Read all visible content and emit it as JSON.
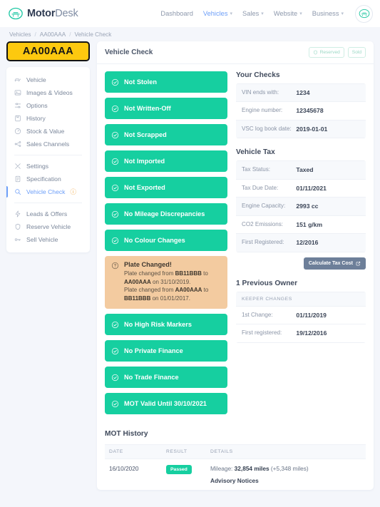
{
  "brand": {
    "name_bold": "Motor",
    "name_light": "Desk",
    "logo_icon": "car-icon"
  },
  "nav": {
    "items": [
      {
        "label": "Dashboard",
        "caret": false,
        "active": false
      },
      {
        "label": "Vehicles",
        "caret": true,
        "active": true
      },
      {
        "label": "Sales",
        "caret": true,
        "active": false
      },
      {
        "label": "Website",
        "caret": true,
        "active": false
      },
      {
        "label": "Business",
        "caret": true,
        "active": false
      }
    ],
    "caret_glyph": "⌄",
    "avatar_icon": "car-avatar-icon"
  },
  "breadcrumb": {
    "items": [
      "Vehicles",
      "AA00AAA",
      "Vehicle Check"
    ],
    "separator": "/"
  },
  "sidebar": {
    "plate": "AA00AAA",
    "groups": [
      {
        "items": [
          {
            "label": "Vehicle",
            "icon": "car-icon",
            "active": false
          },
          {
            "label": "Images & Videos",
            "icon": "image-icon",
            "active": false
          },
          {
            "label": "Options",
            "icon": "sliders-icon",
            "active": false
          },
          {
            "label": "History",
            "icon": "book-icon",
            "active": false
          },
          {
            "label": "Stock & Value",
            "icon": "gauge-icon",
            "active": false
          },
          {
            "label": "Sales Channels",
            "icon": "share-icon",
            "active": false
          }
        ]
      },
      {
        "items": [
          {
            "label": "Settings",
            "icon": "tools-icon",
            "active": false
          },
          {
            "label": "Specification",
            "icon": "document-icon",
            "active": false
          },
          {
            "label": "Vehicle Check",
            "icon": "search-icon",
            "active": true,
            "warning_icon": "warning-question-icon"
          }
        ]
      },
      {
        "items": [
          {
            "label": "Leads & Offers",
            "icon": "bolt-icon",
            "active": false
          },
          {
            "label": "Reserve Vehicle",
            "icon": "shield-icon",
            "active": false
          },
          {
            "label": "Sell Vehicle",
            "icon": "key-icon",
            "active": false
          }
        ]
      }
    ]
  },
  "page": {
    "title": "Vehicle Check",
    "header_buttons": [
      {
        "label": "Reserved",
        "icon": "shield-icon"
      },
      {
        "label": "Sold",
        "icon": null
      }
    ]
  },
  "checks": [
    {
      "label": "Not Stolen",
      "status": "ok",
      "icon": "check-circle-icon"
    },
    {
      "label": "Not Written-Off",
      "status": "ok",
      "icon": "check-circle-icon"
    },
    {
      "label": "Not Scrapped",
      "status": "ok",
      "icon": "check-circle-icon"
    },
    {
      "label": "Not Imported",
      "status": "ok",
      "icon": "check-circle-icon"
    },
    {
      "label": "Not Exported",
      "status": "ok",
      "icon": "check-circle-icon"
    },
    {
      "label": "No Mileage Discrepancies",
      "status": "ok",
      "icon": "check-circle-icon"
    },
    {
      "label": "No Colour Changes",
      "status": "ok",
      "icon": "check-circle-icon"
    }
  ],
  "plate_warning": {
    "title": "Plate Changed!",
    "icon": "question-circle-icon",
    "lines": [
      {
        "pre": "Plate changed from ",
        "b1": "BB11BBB",
        "mid": " to ",
        "b2": "AA00AAA",
        "post": " on 31/10/2019."
      },
      {
        "pre": "Plate changed from ",
        "b1": "AA00AAA",
        "mid": " to ",
        "b2": "BB11BBB",
        "post": " on 01/01/2017."
      }
    ]
  },
  "checks_after": [
    {
      "label": "No High Risk Markers",
      "status": "ok",
      "icon": "check-circle-icon"
    },
    {
      "label": "No Private Finance",
      "status": "ok",
      "icon": "check-circle-icon"
    },
    {
      "label": "No Trade Finance",
      "status": "ok",
      "icon": "check-circle-icon"
    },
    {
      "label": "MOT Valid Until 30/10/2021",
      "status": "ok",
      "icon": "check-circle-icon"
    }
  ],
  "your_checks": {
    "title": "Your Checks",
    "rows": [
      {
        "key": "VIN ends with:",
        "value": "1234"
      },
      {
        "key": "Engine number:",
        "value": "12345678"
      },
      {
        "key": "VSC log book date:",
        "value": "2019-01-01"
      }
    ]
  },
  "vehicle_tax": {
    "title": "Vehicle Tax",
    "rows": [
      {
        "key": "Tax Status:",
        "value": "Taxed"
      },
      {
        "key": "Tax Due Date:",
        "value": "01/11/2021"
      },
      {
        "key": "Engine Capacity:",
        "value": "2993 cc"
      },
      {
        "key": "CO2 Emissions:",
        "value": "151 g/km"
      },
      {
        "key": "First Registered:",
        "value": "12/2016"
      }
    ],
    "button": {
      "label": "Calculate Tax Cost",
      "icon": "external-link-icon"
    }
  },
  "owners": {
    "title": "1 Previous Owner",
    "table_header": "KEEPER CHANGES",
    "rows": [
      {
        "key": "1st Change:",
        "value": "01/11/2019"
      },
      {
        "key": "First registered:",
        "value": "19/12/2016"
      }
    ]
  },
  "mot_history": {
    "title": "MOT History",
    "columns": [
      "DATE",
      "RESULT",
      "DETAILS"
    ],
    "rows": [
      {
        "date": "16/10/2020",
        "result": "Passed",
        "mileage_label": "Mileage: ",
        "mileage_value": "32,854 miles",
        "mileage_delta": " (+5,348 miles)",
        "advisory": "Advisory Notices"
      }
    ]
  },
  "colors": {
    "accent_green": "#16cfa0",
    "accent_blue": "#6c9ef8",
    "warning_bg": "#f3cba0",
    "plate_yellow": "#fdc90f",
    "button_slate": "#6d7f99"
  }
}
